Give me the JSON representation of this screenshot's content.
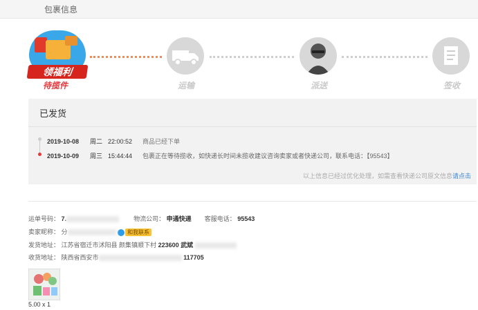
{
  "header": {
    "title": "包裹信息"
  },
  "promo": {
    "banner": "领福利"
  },
  "steps": [
    {
      "label": "待揽件",
      "icon": "gift-box-icon"
    },
    {
      "label": "运输",
      "icon": "truck-icon"
    },
    {
      "label": "派送",
      "icon": "courier-icon"
    },
    {
      "label": "签收",
      "icon": "document-icon"
    }
  ],
  "logistics": {
    "status": "已发货",
    "events": [
      {
        "date": "2019-10-08",
        "weekday": "周二",
        "time": "22:00:52",
        "desc": "商品已经下单"
      },
      {
        "date": "2019-10-09",
        "weekday": "周三",
        "time": "15:44:44",
        "desc": "包裹正在等待揽收，如快递长时间未揽收建议咨询卖家或者快递公司，联系电话：【95543】"
      }
    ],
    "note": "以上信息已经过优化处理，如需查看快递公司原文信息",
    "note_link": "请点击"
  },
  "details": {
    "waybill_label": "运单号码：",
    "waybill_value": "7.",
    "company_label": "物流公司：",
    "company_value": "申通快递",
    "phone_label": "客服电话：",
    "phone_value": "95543",
    "seller_label": "卖家昵称：",
    "seller_value": "分",
    "contact_label": "和我联系",
    "ship_from_label": "发货地址：",
    "ship_from_value": "江苏省宿迁市沭阳县 颜集镇顺下村",
    "ship_from_zip": "223600",
    "ship_from_name": "武斌",
    "ship_to_label": "收货地址：",
    "ship_to_value": "陕西省西安市",
    "ship_to_zip": "117705"
  },
  "product": {
    "quantity": "5.00 x 1"
  },
  "colors": {
    "accent": "#e4393c",
    "link": "#3b86d6",
    "active_dot": "#f08a5d"
  }
}
